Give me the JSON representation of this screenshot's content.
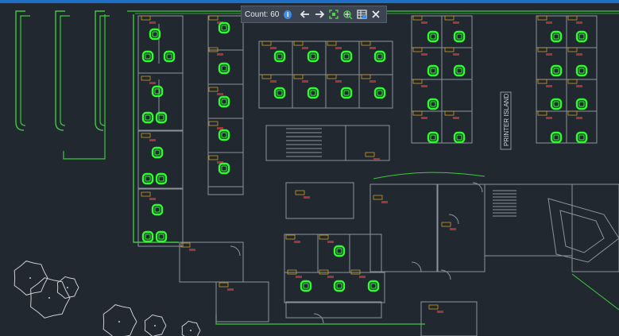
{
  "toolbar": {
    "count_text": "Count: 60",
    "info_glyph": "i",
    "buttons": [
      {
        "name": "previous-arrow-icon"
      },
      {
        "name": "next-arrow-icon"
      },
      {
        "name": "zoom-to-extents-icon"
      },
      {
        "name": "select-objects-icon"
      },
      {
        "name": "insert-table-icon"
      },
      {
        "name": "close-icon"
      }
    ]
  },
  "drawing": {
    "island_label": "PRINTER ISLAND",
    "highlight_color": "#2bff2b",
    "line_color": "#8a939c",
    "wall_color": "#3ec93e",
    "tag_color": "#c99a2e",
    "note_color": "#d13f3f"
  }
}
